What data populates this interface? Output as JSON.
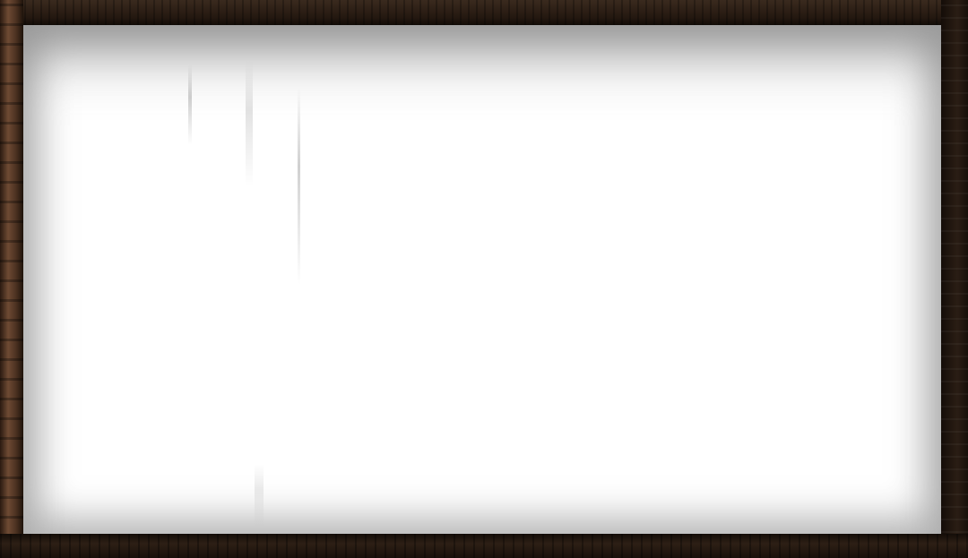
{
  "scene": {
    "frame_style": "dark-wood",
    "panel_color": "#ffffff",
    "frame_colors": [
      "#2a1c12",
      "#3b2a1d",
      "#1d140d"
    ]
  }
}
